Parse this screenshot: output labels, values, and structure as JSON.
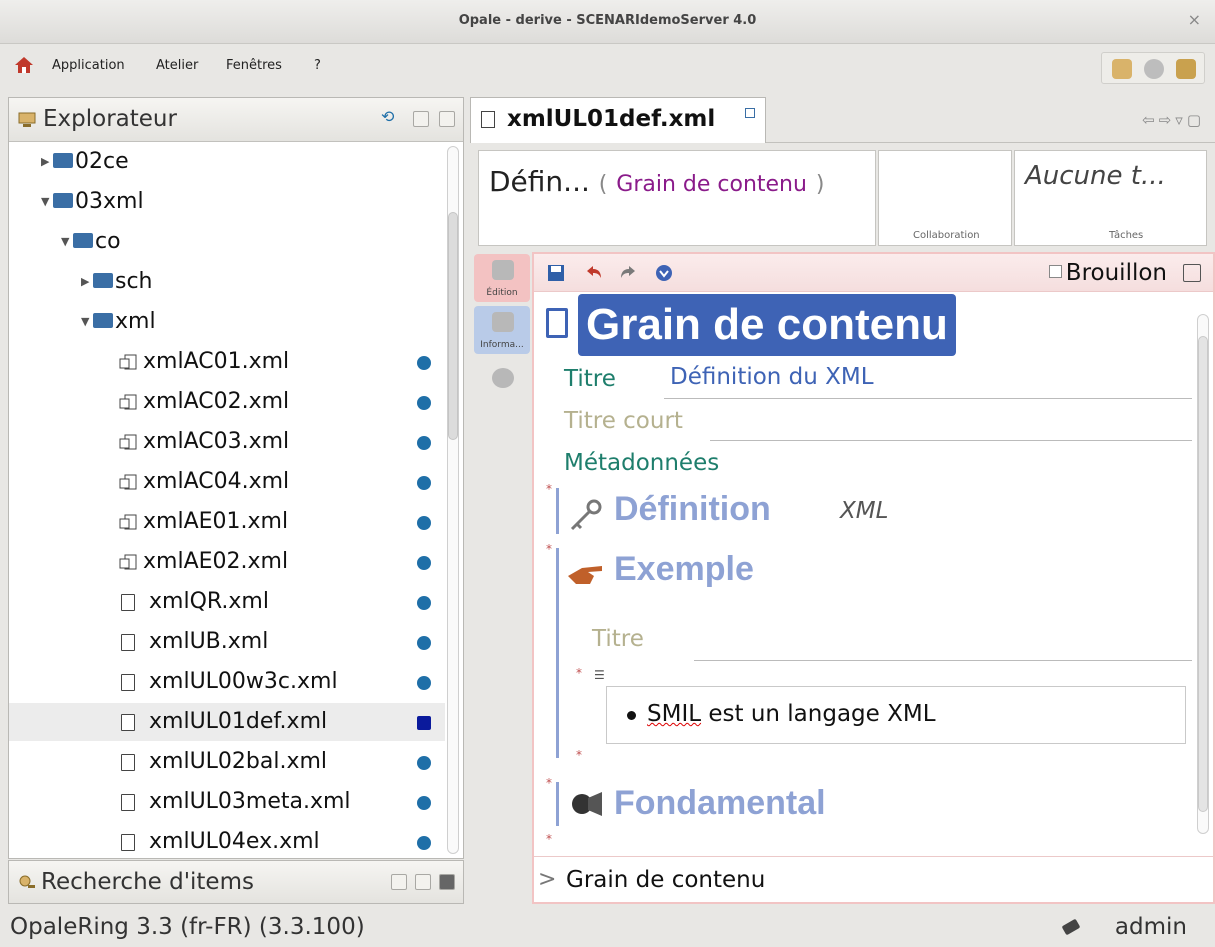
{
  "window": {
    "title": "Opale - derive - SCENARIdemoServer 4.0",
    "close_glyph": "×"
  },
  "menubar": {
    "items": [
      "Application",
      "Atelier",
      "Fenêtres",
      "?"
    ]
  },
  "explorer": {
    "title": "Explorateur",
    "items": [
      {
        "label": "02ce",
        "type": "folder",
        "expanded": false
      },
      {
        "label": "03xml",
        "type": "folder",
        "expanded": true
      },
      {
        "label": "co",
        "type": "folder",
        "expanded": true
      },
      {
        "label": "sch",
        "type": "folder",
        "expanded": false
      },
      {
        "label": "xml",
        "type": "folder",
        "expanded": true
      },
      {
        "label": "xmlAC01.xml",
        "type": "multi-file"
      },
      {
        "label": "xmlAC02.xml",
        "type": "multi-file"
      },
      {
        "label": "xmlAC03.xml",
        "type": "multi-file"
      },
      {
        "label": "xmlAC04.xml",
        "type": "multi-file"
      },
      {
        "label": "xmlAE01.xml",
        "type": "multi-file"
      },
      {
        "label": "xmlAE02.xml",
        "type": "multi-file"
      },
      {
        "label": "xmlQR.xml",
        "type": "file"
      },
      {
        "label": "xmlUB.xml",
        "type": "file"
      },
      {
        "label": "xmlUL00w3c.xml",
        "type": "file"
      },
      {
        "label": "xmlUL01def.xml",
        "type": "file",
        "selected": true
      },
      {
        "label": "xmlUL02bal.xml",
        "type": "file"
      },
      {
        "label": "xmlUL03meta.xml",
        "type": "file"
      },
      {
        "label": "xmlUL04ex.xml",
        "type": "file"
      }
    ]
  },
  "search_panel": {
    "title": "Recherche d'items"
  },
  "statusbar": {
    "version": "OpaleRing 3.3 (fr-FR) (3.3.100)",
    "user": "admin"
  },
  "editor": {
    "tab_label": "xmlUL01def.xml",
    "info": {
      "title_short": "Défin...",
      "model_open": "(",
      "model": "Grain de contenu",
      "model_close": ")",
      "collab_label": "Collaboration",
      "tasks_value": "Aucune t...",
      "tasks_label": "Tâches"
    },
    "side_tabs": [
      "Édition",
      "Informa..."
    ],
    "brouillon": "Brouillon",
    "grain_title": "Grain de contenu",
    "fields": {
      "titre_label": "Titre",
      "titre_value": "Définition du XML",
      "titre_court_label": "Titre court",
      "metadonnees_label": "Métadonnées"
    },
    "sections": {
      "definition_title": "Définition",
      "definition_extra": "XML",
      "exemple_title": "Exemple",
      "exemple_titre_label": "Titre",
      "bullet_word": "SMIL",
      "bullet_rest": " est un langage XML",
      "fondamental_title": "Fondamental"
    },
    "breadcrumb": "Grain de contenu",
    "breadcrumb_sep": ">",
    "star": "*"
  }
}
